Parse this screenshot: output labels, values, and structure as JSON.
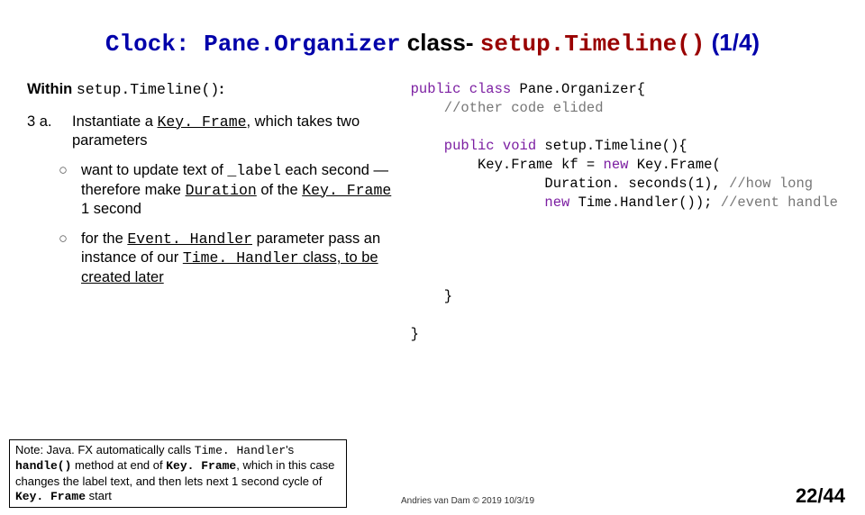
{
  "title": {
    "clock": "Clock: Pane.Organizer",
    "class_word": " class- ",
    "setup": "setup.Timeline()",
    "page_part": " (1/4)"
  },
  "within_label": "Within ",
  "within_code": "setup.Timeline()",
  "within_colon": ":",
  "step3a_label": "3 a.",
  "step3a_pre": "Instantiate a ",
  "step3a_code": "Key. Frame",
  "step3a_post": ", which takes two parameters",
  "sub1_pre": "want to update text of  ",
  "sub1_label": "_label",
  "sub1_mid": " each second — therefore make ",
  "sub1_dur": "Duration",
  "sub1_of": " of the ",
  "sub1_kf": "Key. Frame",
  "sub1_end": " 1 second",
  "sub2_pre": "for the ",
  "sub2_eh": "Event. Handler",
  "sub2_mid": " parameter pass an instance of our ",
  "sub2_th": "Time. Handler",
  "sub2_end": " class, to be created later",
  "bullet": "○",
  "note_a": "Note: Java. FX automatically  calls ",
  "note_th": "Time. Handler",
  "note_b": "'s ",
  "note_handle": "handle()",
  "note_c": "  method at end of ",
  "note_kf": "Key. Frame",
  "note_d": ", which in this case changes the label text, and then lets next 1 second cycle of ",
  "note_kf2": "Key. Frame",
  "note_e": " start",
  "code": {
    "l1a": "public",
    "l1b": " class",
    "l1c": " Pane.Organizer{",
    "l2": "    //other code elided",
    "l3a": "    public",
    "l3b": " void",
    "l3c": " setup.Timeline(){",
    "l4": "        Key.Frame kf = ",
    "l4b": "new",
    "l4c": " Key.Frame(",
    "l5": "                Duration. seconds(1), ",
    "l5c": "//how long",
    "l6a": "                ",
    "l6b": "new",
    "l6c": " Time.Handler()); ",
    "l6d": "//event handle",
    "l7": "    }",
    "l8": "}"
  },
  "credit": "Andries van Dam © 2019 10/3/19",
  "page_num": "22/44"
}
